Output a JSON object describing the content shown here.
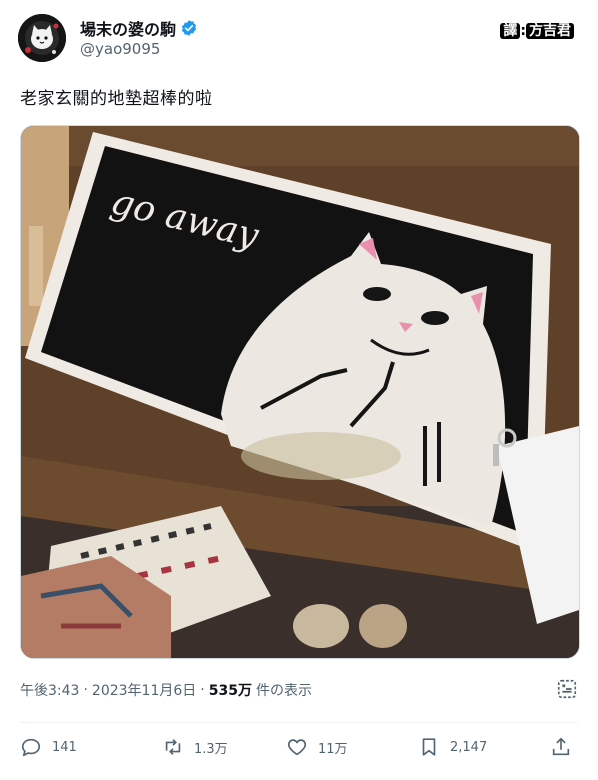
{
  "author": {
    "display_name": "場末の婆の駒",
    "handle": "@yao9095",
    "avatar_icon": "avatar-cat-icon",
    "verified_icon": "verified-badge-icon",
    "verified_color": "#1d9bf0"
  },
  "credit": {
    "prefix": "譯",
    "name": "方吉君"
  },
  "tweet": {
    "text": "老家玄關的地墊超棒的啦",
    "image": {
      "mat_text": "go away",
      "description_icon": "doormat-photo"
    }
  },
  "meta": {
    "time": "午後3:43",
    "separator": "·",
    "date": "2023年11月6日",
    "views_count": "535万",
    "views_label": "件の表示"
  },
  "actions": {
    "reply": {
      "icon": "reply-icon",
      "count": "141"
    },
    "repost": {
      "icon": "repost-icon",
      "count": "1.3万"
    },
    "like": {
      "icon": "heart-icon",
      "count": "11万"
    },
    "bookmark": {
      "icon": "bookmark-icon",
      "count": "2,147"
    },
    "share": {
      "icon": "share-icon"
    }
  },
  "colors": {
    "text_primary": "#0f1419",
    "text_secondary": "#536471",
    "divider": "#eff3f4"
  }
}
